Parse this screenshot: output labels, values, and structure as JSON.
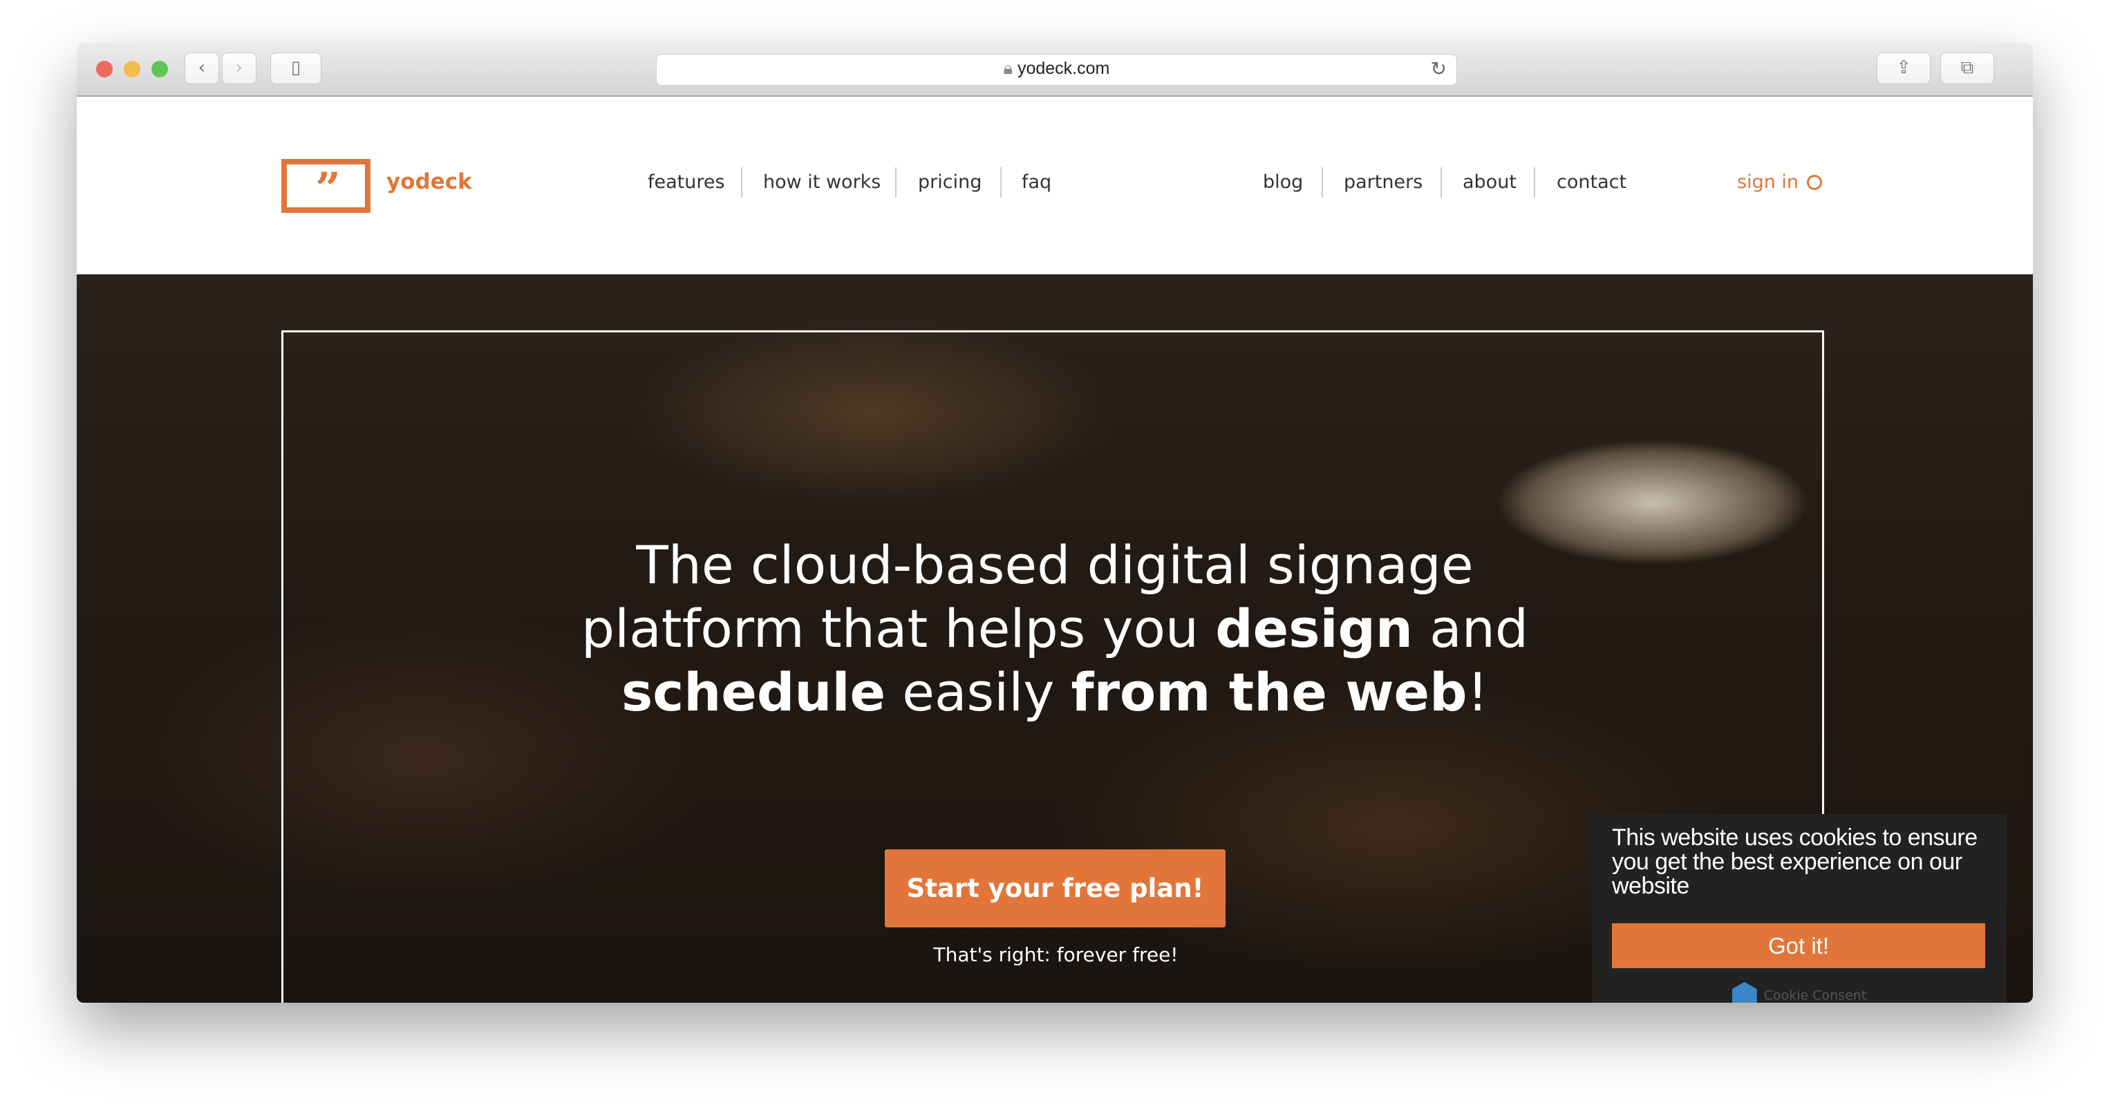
{
  "browser": {
    "url": "yodeck.com",
    "traffic_lights": {
      "close": "#ee6a5f",
      "minimize": "#f5bd4f",
      "zoom": "#61c454"
    }
  },
  "header": {
    "logo_text": "yodeck",
    "logo_glyph": "”",
    "nav_left": [
      "features",
      "how it works",
      "pricing",
      "faq"
    ],
    "nav_right": [
      "blog",
      "partners",
      "about",
      "contact"
    ],
    "sign_in": "sign in"
  },
  "hero": {
    "line1": "The cloud-based digital signage",
    "line2_a": "platform that helps you ",
    "line2_b": "design",
    "line2_c": " and",
    "line3_a": "schedule",
    "line3_b": " easily ",
    "line3_c": "from the web",
    "line3_d": "!",
    "cta": "Start your free plan!",
    "subtext": "That's right: forever free!"
  },
  "cookie": {
    "message": "This website uses cookies to ensure you get the best experience on our website",
    "button": "Got it!",
    "brand": "Cookie Consent"
  },
  "colors": {
    "accent": "#e2763a",
    "cookie_bg": "#222222"
  }
}
